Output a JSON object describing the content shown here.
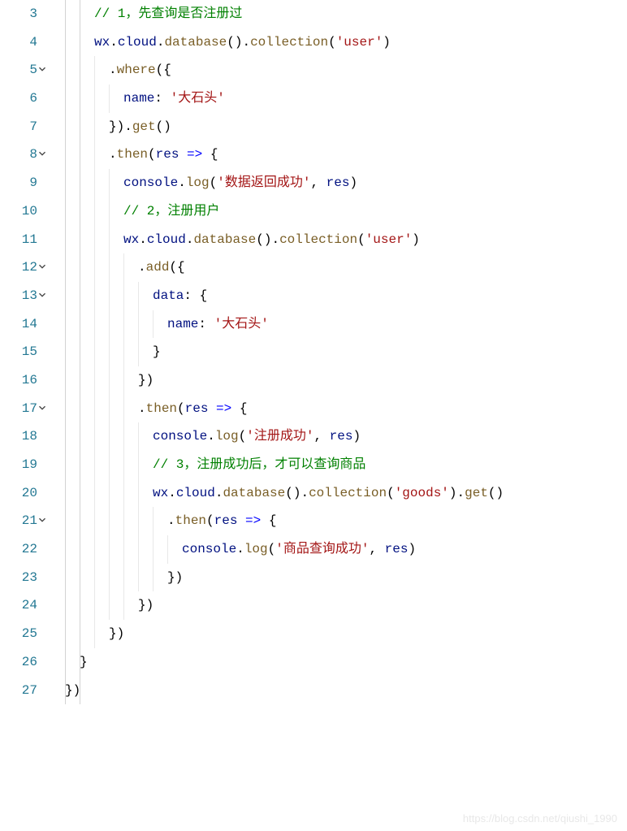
{
  "watermark": "https://blog.csdn.net/qiushi_1990",
  "lines": [
    {
      "num": 3,
      "fold": false,
      "indent": 2,
      "tokens": [
        {
          "t": "// 1，先查询是否注册过",
          "c": "c-comment"
        }
      ]
    },
    {
      "num": 4,
      "fold": false,
      "indent": 2,
      "tokens": [
        {
          "t": "wx",
          "c": "c-ident"
        },
        {
          "t": ".",
          "c": "c-punct"
        },
        {
          "t": "cloud",
          "c": "c-ident"
        },
        {
          "t": ".",
          "c": "c-punct"
        },
        {
          "t": "database",
          "c": "c-method"
        },
        {
          "t": "().",
          "c": "c-punct"
        },
        {
          "t": "collection",
          "c": "c-method"
        },
        {
          "t": "(",
          "c": "c-punct"
        },
        {
          "t": "'user'",
          "c": "c-string"
        },
        {
          "t": ")",
          "c": "c-punct"
        }
      ]
    },
    {
      "num": 5,
      "fold": true,
      "indent": 3,
      "tokens": [
        {
          "t": ".",
          "c": "c-punct"
        },
        {
          "t": "where",
          "c": "c-method"
        },
        {
          "t": "({",
          "c": "c-punct"
        }
      ]
    },
    {
      "num": 6,
      "fold": false,
      "indent": 4,
      "tokens": [
        {
          "t": "name",
          "c": "c-prop"
        },
        {
          "t": ": ",
          "c": "c-punct"
        },
        {
          "t": "'大石头'",
          "c": "c-string"
        }
      ]
    },
    {
      "num": 7,
      "fold": false,
      "indent": 3,
      "tokens": [
        {
          "t": "}).",
          "c": "c-punct"
        },
        {
          "t": "get",
          "c": "c-method"
        },
        {
          "t": "()",
          "c": "c-punct"
        }
      ]
    },
    {
      "num": 8,
      "fold": true,
      "indent": 3,
      "tokens": [
        {
          "t": ".",
          "c": "c-punct"
        },
        {
          "t": "then",
          "c": "c-method"
        },
        {
          "t": "(",
          "c": "c-punct"
        },
        {
          "t": "res",
          "c": "c-param"
        },
        {
          "t": " ",
          "c": "c-punct"
        },
        {
          "t": "=>",
          "c": "c-keyword"
        },
        {
          "t": " {",
          "c": "c-punct"
        }
      ]
    },
    {
      "num": 9,
      "fold": false,
      "indent": 4,
      "tokens": [
        {
          "t": "console",
          "c": "c-ident"
        },
        {
          "t": ".",
          "c": "c-punct"
        },
        {
          "t": "log",
          "c": "c-method"
        },
        {
          "t": "(",
          "c": "c-punct"
        },
        {
          "t": "'数据返回成功'",
          "c": "c-string"
        },
        {
          "t": ", ",
          "c": "c-punct"
        },
        {
          "t": "res",
          "c": "c-ident"
        },
        {
          "t": ")",
          "c": "c-punct"
        }
      ]
    },
    {
      "num": 10,
      "fold": false,
      "indent": 4,
      "tokens": [
        {
          "t": "// 2，注册用户",
          "c": "c-comment"
        }
      ]
    },
    {
      "num": 11,
      "fold": false,
      "indent": 4,
      "tokens": [
        {
          "t": "wx",
          "c": "c-ident"
        },
        {
          "t": ".",
          "c": "c-punct"
        },
        {
          "t": "cloud",
          "c": "c-ident"
        },
        {
          "t": ".",
          "c": "c-punct"
        },
        {
          "t": "database",
          "c": "c-method"
        },
        {
          "t": "().",
          "c": "c-punct"
        },
        {
          "t": "collection",
          "c": "c-method"
        },
        {
          "t": "(",
          "c": "c-punct"
        },
        {
          "t": "'user'",
          "c": "c-string"
        },
        {
          "t": ")",
          "c": "c-punct"
        }
      ]
    },
    {
      "num": 12,
      "fold": true,
      "indent": 5,
      "tokens": [
        {
          "t": ".",
          "c": "c-punct"
        },
        {
          "t": "add",
          "c": "c-method"
        },
        {
          "t": "({",
          "c": "c-punct"
        }
      ]
    },
    {
      "num": 13,
      "fold": true,
      "indent": 6,
      "tokens": [
        {
          "t": "data",
          "c": "c-prop"
        },
        {
          "t": ": {",
          "c": "c-punct"
        }
      ]
    },
    {
      "num": 14,
      "fold": false,
      "indent": 7,
      "tokens": [
        {
          "t": "name",
          "c": "c-prop"
        },
        {
          "t": ": ",
          "c": "c-punct"
        },
        {
          "t": "'大石头'",
          "c": "c-string"
        }
      ]
    },
    {
      "num": 15,
      "fold": false,
      "indent": 6,
      "tokens": [
        {
          "t": "}",
          "c": "c-punct"
        }
      ]
    },
    {
      "num": 16,
      "fold": false,
      "indent": 5,
      "tokens": [
        {
          "t": "})",
          "c": "c-punct"
        }
      ]
    },
    {
      "num": 17,
      "fold": true,
      "indent": 5,
      "tokens": [
        {
          "t": ".",
          "c": "c-punct"
        },
        {
          "t": "then",
          "c": "c-method"
        },
        {
          "t": "(",
          "c": "c-punct"
        },
        {
          "t": "res",
          "c": "c-param"
        },
        {
          "t": " ",
          "c": "c-punct"
        },
        {
          "t": "=>",
          "c": "c-keyword"
        },
        {
          "t": " {",
          "c": "c-punct"
        }
      ]
    },
    {
      "num": 18,
      "fold": false,
      "indent": 6,
      "tokens": [
        {
          "t": "console",
          "c": "c-ident"
        },
        {
          "t": ".",
          "c": "c-punct"
        },
        {
          "t": "log",
          "c": "c-method"
        },
        {
          "t": "(",
          "c": "c-punct"
        },
        {
          "t": "'注册成功'",
          "c": "c-string"
        },
        {
          "t": ", ",
          "c": "c-punct"
        },
        {
          "t": "res",
          "c": "c-ident"
        },
        {
          "t": ")",
          "c": "c-punct"
        }
      ]
    },
    {
      "num": 19,
      "fold": false,
      "indent": 6,
      "tokens": [
        {
          "t": "// 3，注册成功后，才可以查询商品",
          "c": "c-comment"
        }
      ]
    },
    {
      "num": 20,
      "fold": false,
      "indent": 6,
      "tokens": [
        {
          "t": "wx",
          "c": "c-ident"
        },
        {
          "t": ".",
          "c": "c-punct"
        },
        {
          "t": "cloud",
          "c": "c-ident"
        },
        {
          "t": ".",
          "c": "c-punct"
        },
        {
          "t": "database",
          "c": "c-method"
        },
        {
          "t": "().",
          "c": "c-punct"
        },
        {
          "t": "collection",
          "c": "c-method"
        },
        {
          "t": "(",
          "c": "c-punct"
        },
        {
          "t": "'goods'",
          "c": "c-string"
        },
        {
          "t": ").",
          "c": "c-punct"
        },
        {
          "t": "get",
          "c": "c-method"
        },
        {
          "t": "()",
          "c": "c-punct"
        }
      ]
    },
    {
      "num": 21,
      "fold": true,
      "indent": 7,
      "tokens": [
        {
          "t": ".",
          "c": "c-punct"
        },
        {
          "t": "then",
          "c": "c-method"
        },
        {
          "t": "(",
          "c": "c-punct"
        },
        {
          "t": "res",
          "c": "c-param"
        },
        {
          "t": " ",
          "c": "c-punct"
        },
        {
          "t": "=>",
          "c": "c-keyword"
        },
        {
          "t": " {",
          "c": "c-punct"
        }
      ]
    },
    {
      "num": 22,
      "fold": false,
      "indent": 8,
      "tokens": [
        {
          "t": "console",
          "c": "c-ident"
        },
        {
          "t": ".",
          "c": "c-punct"
        },
        {
          "t": "log",
          "c": "c-method"
        },
        {
          "t": "(",
          "c": "c-punct"
        },
        {
          "t": "'商品查询成功'",
          "c": "c-string"
        },
        {
          "t": ", ",
          "c": "c-punct"
        },
        {
          "t": "res",
          "c": "c-ident"
        },
        {
          "t": ")",
          "c": "c-punct"
        }
      ]
    },
    {
      "num": 23,
      "fold": false,
      "indent": 7,
      "tokens": [
        {
          "t": "})",
          "c": "c-punct"
        }
      ]
    },
    {
      "num": 24,
      "fold": false,
      "indent": 5,
      "tokens": [
        {
          "t": "})",
          "c": "c-punct"
        }
      ]
    },
    {
      "num": 25,
      "fold": false,
      "indent": 3,
      "tokens": [
        {
          "t": "})",
          "c": "c-punct"
        }
      ]
    },
    {
      "num": 26,
      "fold": false,
      "indent": 1,
      "tokens": [
        {
          "t": "}",
          "c": "c-punct"
        }
      ]
    },
    {
      "num": 27,
      "fold": false,
      "indent": 0,
      "tokens": [
        {
          "t": "})",
          "c": "c-punct"
        }
      ]
    }
  ],
  "indentGuides": [
    0,
    1
  ]
}
